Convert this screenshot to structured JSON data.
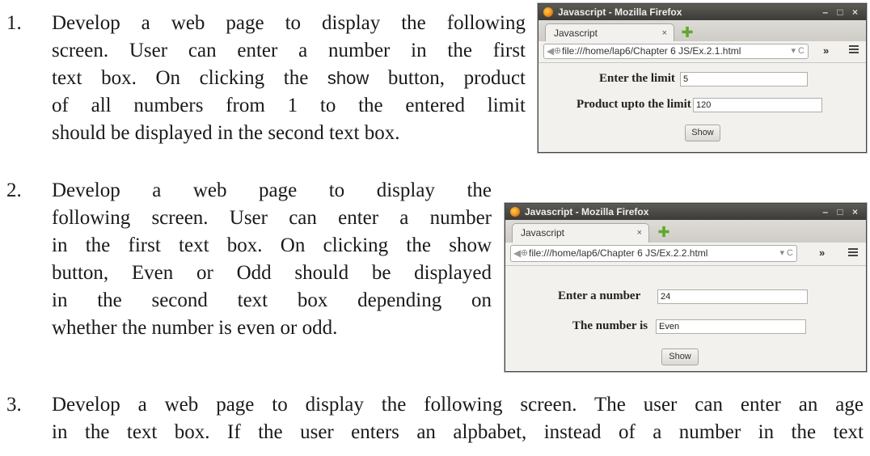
{
  "questions": [
    {
      "number": "1.",
      "lines": [
        "Develop  a web page to display the following",
        "screen. User can enter a number in the first",
        "text box. On clicking the",
        "button, product",
        "of all numbers from 1 to the entered limit",
        "should be displayed in the second text box."
      ],
      "keyword": "show"
    },
    {
      "number": "2.",
      "lines": [
        "Develop  a web page to display the",
        "following screen. User can enter a number",
        "in the first text box. On clicking the show",
        "button, Even or Odd should be displayed",
        "in the second text box depending on",
        "whether the number is even or odd."
      ]
    },
    {
      "number": "3.",
      "lines": [
        "Develop a web page to display the following screen. The user can enter an age",
        "in the text box. If  the user enters an alpbabet, instead of a number in the text"
      ]
    }
  ],
  "windows": [
    {
      "title": "Javascript - Mozilla Firefox",
      "tab": "Javascript",
      "url": "file:///home/lap6/Chapter 6 JS/Ex.2.1.html",
      "field1_label": "Enter the limit",
      "field1_value": "5",
      "field2_label": "Product upto the limit",
      "field2_value": "120",
      "button": "Show"
    },
    {
      "title": "Javascript - Mozilla Firefox",
      "tab": "Javascript",
      "url": "file:///home/lap6/Chapter 6 JS/Ex.2.2.html",
      "field1_label": "Enter a number",
      "field1_value": "24",
      "field2_label": "The number is",
      "field2_value": "Even",
      "button": "Show"
    }
  ],
  "icons": {
    "close": "×",
    "back": "◀",
    "globe": "⊕",
    "dropdown_reload": "▾ C",
    "overflow": "»",
    "window_controls": "– □ ×",
    "new_tab": "✚"
  }
}
